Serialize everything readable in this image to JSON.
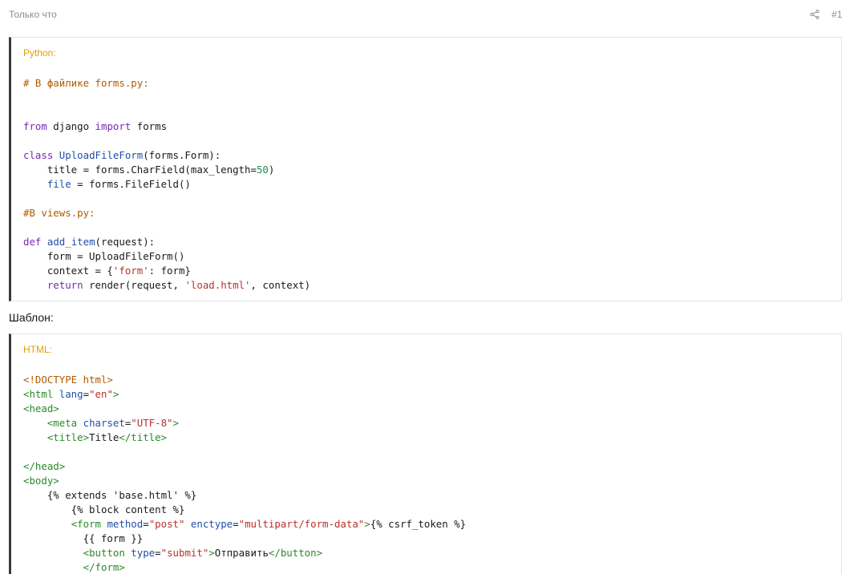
{
  "header": {
    "time": "Только что",
    "share_icon": "share-icon",
    "post_number": "#1"
  },
  "python_block": {
    "title": "Python:",
    "lines": [
      [
        [
          "cm",
          "# В файлике forms.py:"
        ]
      ],
      [],
      [],
      [
        [
          "kw",
          "from"
        ],
        [
          "plain",
          " django "
        ],
        [
          "kw",
          "import"
        ],
        [
          "plain",
          " forms"
        ]
      ],
      [],
      [
        [
          "kw",
          "class"
        ],
        [
          "plain",
          " "
        ],
        [
          "cls",
          "UploadFileForm"
        ],
        [
          "plain",
          "(forms.Form):"
        ]
      ],
      [
        [
          "plain",
          "    title = forms.CharField(max_length="
        ],
        [
          "num",
          "50"
        ],
        [
          "plain",
          ")"
        ]
      ],
      [
        [
          "plain",
          "    "
        ],
        [
          "fn",
          "file"
        ],
        [
          "plain",
          " = forms.FileField()"
        ]
      ],
      [],
      [
        [
          "cm",
          "#В views.py:"
        ]
      ],
      [],
      [
        [
          "kw",
          "def"
        ],
        [
          "plain",
          " "
        ],
        [
          "fn",
          "add_item"
        ],
        [
          "plain",
          "(request):"
        ]
      ],
      [
        [
          "plain",
          "    form = UploadFileForm()"
        ]
      ],
      [
        [
          "plain",
          "    context = {"
        ],
        [
          "str",
          "'form'"
        ],
        [
          "plain",
          ": form}"
        ]
      ],
      [
        [
          "plain",
          "    "
        ],
        [
          "kw",
          "return"
        ],
        [
          "plain",
          " render(request, "
        ],
        [
          "str",
          "'load.html'"
        ],
        [
          "plain",
          ", context)"
        ]
      ]
    ]
  },
  "between_text": "Шаблон:",
  "html_block": {
    "title": "HTML:",
    "lines": [
      [
        [
          "doctype",
          "<!DOCTYPE html>"
        ]
      ],
      [
        [
          "tag",
          "<html "
        ],
        [
          "attr",
          "lang"
        ],
        [
          "plain",
          "="
        ],
        [
          "str",
          "\"en\""
        ],
        [
          "tag",
          ">"
        ]
      ],
      [
        [
          "tag",
          "<head>"
        ]
      ],
      [
        [
          "plain",
          "    "
        ],
        [
          "tag",
          "<meta "
        ],
        [
          "attr",
          "charset"
        ],
        [
          "plain",
          "="
        ],
        [
          "str",
          "\"UTF-8\""
        ],
        [
          "tag",
          ">"
        ]
      ],
      [
        [
          "plain",
          "    "
        ],
        [
          "tag",
          "<title>"
        ],
        [
          "plain",
          "Title"
        ],
        [
          "tag",
          "</title>"
        ]
      ],
      [],
      [
        [
          "tag",
          "</head>"
        ]
      ],
      [
        [
          "tag",
          "<body>"
        ]
      ],
      [
        [
          "plain",
          "    {% extends 'base.html' %}"
        ]
      ],
      [
        [
          "plain",
          "        {% block content %}"
        ]
      ],
      [
        [
          "plain",
          "        "
        ],
        [
          "tag",
          "<form "
        ],
        [
          "attr",
          "method"
        ],
        [
          "plain",
          "="
        ],
        [
          "str",
          "\"post\""
        ],
        [
          "plain",
          " "
        ],
        [
          "attr",
          "enctype"
        ],
        [
          "plain",
          "="
        ],
        [
          "str",
          "\"multipart/form-data\""
        ],
        [
          "tag",
          ">"
        ],
        [
          "plain",
          "{% csrf_token %}"
        ]
      ],
      [
        [
          "plain",
          "          {{ form }}"
        ]
      ],
      [
        [
          "plain",
          "          "
        ],
        [
          "tag",
          "<button "
        ],
        [
          "attr",
          "type"
        ],
        [
          "plain",
          "="
        ],
        [
          "str",
          "\"submit\""
        ],
        [
          "tag",
          ">"
        ],
        [
          "plain",
          "Отправить"
        ],
        [
          "tag",
          "</button>"
        ]
      ],
      [
        [
          "plain",
          "          "
        ],
        [
          "tag",
          "</form>"
        ]
      ]
    ]
  }
}
